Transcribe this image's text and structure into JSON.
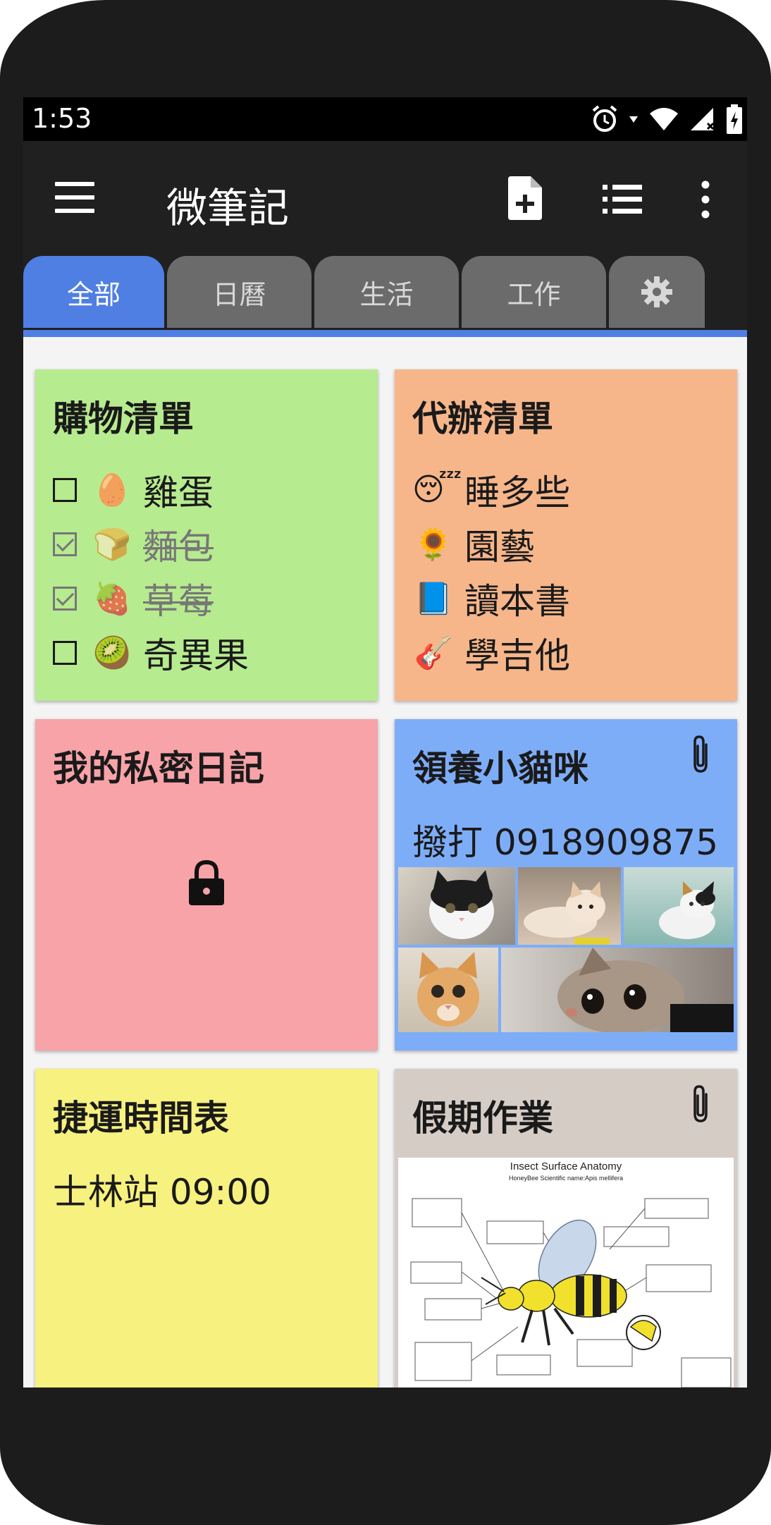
{
  "status_bar": {
    "time": "1:53"
  },
  "app_bar": {
    "title": "微筆記"
  },
  "tabs": [
    {
      "label": "全部",
      "active": true
    },
    {
      "label": "日曆",
      "active": false
    },
    {
      "label": "生活",
      "active": false
    },
    {
      "label": "工作",
      "active": false
    },
    {
      "label": "settings",
      "icon": "gear-icon",
      "active": false
    }
  ],
  "notes": {
    "shopping": {
      "title": "購物清單",
      "color": "#b7eb8f",
      "items": [
        {
          "emoji": "🥚",
          "text": "雞蛋",
          "checked": false
        },
        {
          "emoji": "🍞",
          "text": "麵包",
          "checked": true
        },
        {
          "emoji": "🍓",
          "text": "草莓",
          "checked": true
        },
        {
          "emoji": "🥝",
          "text": "奇異果",
          "checked": false
        }
      ]
    },
    "todo": {
      "title": "代辦清單",
      "color": "#f6b68a",
      "items": [
        {
          "emoji": "😴",
          "text": "睡多些"
        },
        {
          "emoji": "🌻",
          "text": "園藝"
        },
        {
          "emoji": "📘",
          "text": "讀本書"
        },
        {
          "emoji": "🎸",
          "text": "學吉他"
        }
      ]
    },
    "diary": {
      "title": "我的私密日記",
      "color": "#f8a3a8",
      "locked": true,
      "icon": "lock-icon"
    },
    "adopt": {
      "title": "領養小貓咪",
      "color": "#7eadf8",
      "body": "撥打 0918909875",
      "attachment_icon": "paperclip-icon"
    },
    "metro": {
      "title": "捷運時間表",
      "color": "#f7f17f",
      "body": "士林站 09:00"
    },
    "homework": {
      "title": "假期作業",
      "color": "#d6ccc6",
      "attachment_icon": "paperclip-icon",
      "diagram": {
        "title": "Insect Surface Anatomy",
        "subtitle": "HoneyBee",
        "scientific": "Scientific name:Apis mellifera"
      }
    }
  }
}
